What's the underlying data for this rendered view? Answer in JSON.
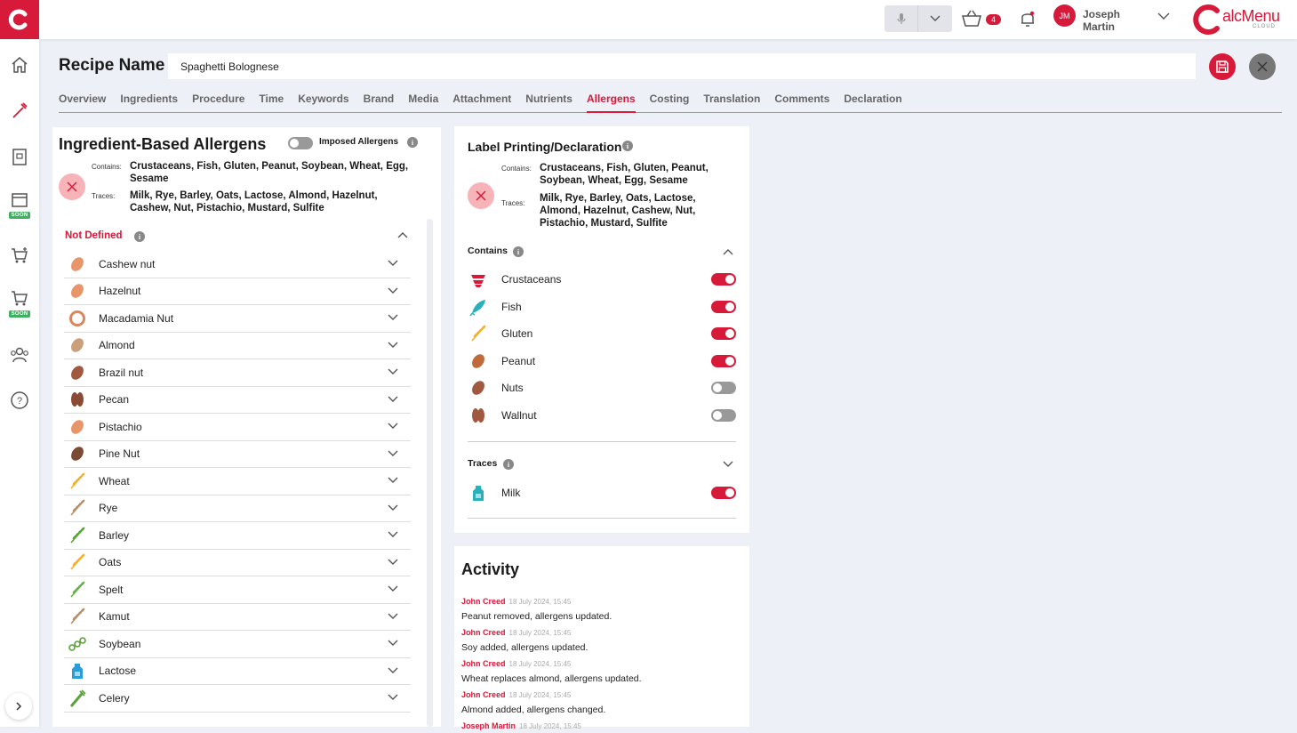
{
  "app": {
    "brand_main": "alcMenu",
    "brand_sub": "CLOUD"
  },
  "sidebar": {
    "items": [
      {
        "name": "home-icon"
      },
      {
        "name": "recipe-icon"
      },
      {
        "name": "menu-book-icon"
      },
      {
        "name": "calendar-icon",
        "badge": "SOON"
      },
      {
        "name": "cart-add-icon"
      },
      {
        "name": "cart-icon",
        "badge": "SOON"
      },
      {
        "name": "users-icon"
      },
      {
        "name": "help-icon"
      }
    ]
  },
  "topbar": {
    "basket_count": "4",
    "user_initials": "JM",
    "user_name": "Joseph\nMartin"
  },
  "recipe": {
    "label": "Recipe Name",
    "value": "Spaghetti Bolognese"
  },
  "tabs": [
    "Overview",
    "Ingredients",
    "Procedure",
    "Time",
    "Keywords",
    "Brand",
    "Media",
    "Attachment",
    "Nutrients",
    "Allergens",
    "Costing",
    "Translation",
    "Comments",
    "Declaration"
  ],
  "active_tab": "Allergens",
  "ingredient_allergens": {
    "title": "Ingredient-Based Allergens",
    "imposed_label": "Imposed Allergens",
    "imposed_on": false,
    "contains_label": "Contains:",
    "contains_value": "Crustaceans, Fish, Gluten, Peanut, Soybean, Wheat, Egg, Sesame",
    "traces_label": "Traces:",
    "traces_value": "Milk, Rye, Barley, Oats, Lactose, Almond, Hazelnut, Cashew, Nut, Pistachio, Mustard, Sulfite",
    "section_title": "Not Defined",
    "items": [
      {
        "name": "Cashew nut",
        "icon": "cashew-icon",
        "color": "#e8956a"
      },
      {
        "name": "Hazelnut",
        "icon": "hazelnut-icon",
        "color": "#e8956a"
      },
      {
        "name": "Macadamia Nut",
        "icon": "macadamia-icon",
        "color": "#d9875e"
      },
      {
        "name": "Almond",
        "icon": "almond-icon",
        "color": "#c9a07a"
      },
      {
        "name": "Brazil nut",
        "icon": "brazil-nut-icon",
        "color": "#a0583e"
      },
      {
        "name": "Pecan",
        "icon": "pecan-icon",
        "color": "#8b4a33"
      },
      {
        "name": "Pistachio",
        "icon": "pistachio-icon",
        "color": "#e8956a"
      },
      {
        "name": "Pine Nut",
        "icon": "pine-nut-icon",
        "color": "#7a4a33"
      },
      {
        "name": "Wheat",
        "icon": "wheat-icon",
        "color": "#f2b030"
      },
      {
        "name": "Rye",
        "icon": "rye-icon",
        "color": "#b8906a"
      },
      {
        "name": "Barley",
        "icon": "barley-icon",
        "color": "#5aa33a"
      },
      {
        "name": "Oats",
        "icon": "oats-icon",
        "color": "#f2b030"
      },
      {
        "name": "Spelt",
        "icon": "spelt-icon",
        "color": "#6ab04a"
      },
      {
        "name": "Kamut",
        "icon": "kamut-icon",
        "color": "#b8906a"
      },
      {
        "name": "Soybean",
        "icon": "soybean-icon",
        "color": "#5aa33a"
      },
      {
        "name": "Lactose",
        "icon": "lactose-icon",
        "color": "#2a9cd7"
      },
      {
        "name": "Celery",
        "icon": "celery-icon",
        "color": "#5aa33a"
      }
    ]
  },
  "label_printing": {
    "title": "Label Printing/Declaration",
    "contains_label": "Contains:",
    "contains_value": "Crustaceans, Fish, Gluten, Peanut, Soybean, Wheat, Egg, Sesame",
    "traces_label": "Traces:",
    "traces_value": "Milk, Rye, Barley, Oats, Lactose, Almond, Hazelnut, Cashew, Nut, Pistachio, Mustard, Sulfite",
    "contains_section": "Contains",
    "contains_items": [
      {
        "name": "Crustaceans",
        "icon": "crustacean-icon",
        "color": "#d7193a",
        "on": true
      },
      {
        "name": "Fish",
        "icon": "fish-icon",
        "color": "#2ab0b8",
        "on": true
      },
      {
        "name": "Gluten",
        "icon": "gluten-icon",
        "color": "#f2b030",
        "on": true
      },
      {
        "name": "Peanut",
        "icon": "peanut-icon",
        "color": "#c06a3a",
        "on": true
      },
      {
        "name": "Nuts",
        "icon": "nuts-icon",
        "color": "#a0583e",
        "on": false
      },
      {
        "name": "Wallnut",
        "icon": "walnut-icon",
        "color": "#a0583e",
        "on": false
      }
    ],
    "traces_section": "Traces",
    "traces_items": [
      {
        "name": "Milk",
        "icon": "milk-icon",
        "color": "#2ab0b8",
        "on": true
      }
    ]
  },
  "activity": {
    "title": "Activity",
    "items": [
      {
        "user": "John Creed",
        "time": "18 July 2024, 15:45",
        "msg": "Peanut removed, allergens updated."
      },
      {
        "user": "John Creed",
        "time": "18 July 2024, 15:45",
        "msg": "Soy added, allergens updated."
      },
      {
        "user": "John Creed",
        "time": "18 July 2024, 15:45",
        "msg": "Wheat replaces almond, allergens updated."
      },
      {
        "user": "John Creed",
        "time": "18 July 2024, 15:45",
        "msg": "Almond added, allergens changed."
      },
      {
        "user": "Joseph Martin",
        "time": "18 July 2024, 15:45",
        "msg": ""
      }
    ]
  }
}
